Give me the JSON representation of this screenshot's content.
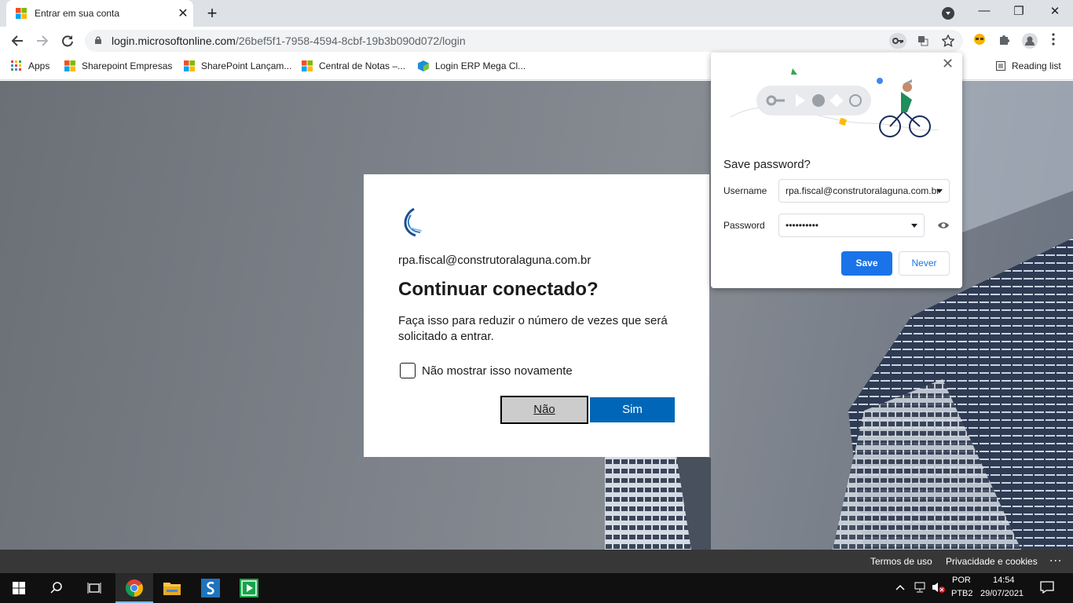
{
  "browser": {
    "tab_title": "Entrar em sua conta",
    "tab_close": "✕",
    "new_tab": "+",
    "url_host": "login.microsoftonline.com",
    "url_path": "/26bef5f1-7958-4594-8cbf-19b3b090d072/login",
    "window_controls": {
      "minimize": "—",
      "maximize": "❐",
      "close": "✕"
    }
  },
  "bookmarks": {
    "items": [
      {
        "label": "Apps",
        "icon": "apps-grid-icon"
      },
      {
        "label": "Sharepoint Empresas",
        "icon": "microsoft-logo-icon"
      },
      {
        "label": "SharePoint Lançam...",
        "icon": "microsoft-logo-icon"
      },
      {
        "label": "Central de Notas –...",
        "icon": "microsoft-logo-icon"
      },
      {
        "label": "Login ERP Mega Cl...",
        "icon": "mega-cube-icon"
      }
    ],
    "reading_list": "Reading list"
  },
  "signin": {
    "email": "rpa.fiscal@construtoralaguna.com.br",
    "heading": "Continuar conectado?",
    "description": "Faça isso para reduzir o número de vezes que será solicitado a entrar.",
    "checkbox_label": "Não mostrar isso novamente",
    "checkbox_checked": false,
    "no_button": "Não",
    "yes_button": "Sim"
  },
  "save_password": {
    "title": "Save password?",
    "username_label": "Username",
    "username_value": "rpa.fiscal@construtoralaguna.com.br",
    "password_label": "Password",
    "password_value": "••••••••••",
    "save_button": "Save",
    "never_button": "Never",
    "close": "✕"
  },
  "footer": {
    "terms": "Termos de uso",
    "privacy": "Privacidade e cookies",
    "more": "..."
  },
  "taskbar": {
    "language_top": "POR",
    "language_bottom": "PTB2",
    "time": "14:54",
    "date": "29/07/2021"
  },
  "colors": {
    "ms_blue": "#0067b8",
    "chrome_blue": "#1a73e8",
    "tab_strip": "#dee1e6"
  }
}
